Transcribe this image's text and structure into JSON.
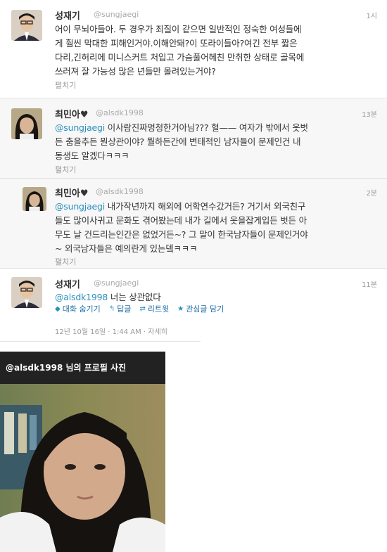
{
  "tweets": [
    {
      "name": "성재기",
      "handle": "@sungjaegi",
      "time": "1시",
      "lines": [
        "어이 무뇌아들아. 두 경우가 죄질이 같으면 일반적인 정숙한 여성들에",
        "게 훨씬 막대한 피해인거야.이해안돼?이 또라이들아?여긴 전부 짧은",
        "다리,긴허리에 미니스커트 처입고 가슴풀어헤친 만취한 상태로 골목에",
        "쓰러져 잘 가능성 많은 년들만 몰려있는거야?"
      ],
      "expand": "펼치기"
    },
    {
      "name": "최민아♥",
      "handle": "@alsdk1998",
      "time": "13분",
      "mention": "@sungjaegi",
      "lines": [
        " 이사람진짜멍청한거아님??? 헐—— 여자가 밖에서 옷벗",
        "든 춤을추든 뭔상관이야? 뭘하든간에 변태적인 남자들이 문제인건 내",
        "동생도 알겠다ㅋㅋㅋ"
      ],
      "expand": "펼치기"
    },
    {
      "name": "최민아♥",
      "handle": "@alsdk1998",
      "time": "2분",
      "mention": "@sungjaegi",
      "lines": [
        " 내가작년까지 해외에 어학연수갔거든? 거기서 외국친구",
        "들도 많이사귀고 문화도 겪어봤는데 내가 길에서 옷을잡게입든 벗든 아",
        "무도 날 건드리는인간은 없었거든~? 그 말이 한국남자들이 문제인거야",
        "~ 외국남자들은 예의란게 있는뎈ㅋㅋㅋ"
      ],
      "expand": "펼치기"
    },
    {
      "name": "성재기",
      "handle": "@sungjaegi",
      "time": "11분",
      "mention": "@alsdk1998",
      "lines": [
        " 너는 상관없다"
      ]
    }
  ],
  "actions": [
    {
      "icon": "speech-icon",
      "label": "대화 숨기기"
    },
    {
      "icon": "reply-icon",
      "label": "답글"
    },
    {
      "icon": "retweet-icon",
      "label": "리트윗"
    },
    {
      "icon": "star-icon",
      "label": "관심글 담기"
    }
  ],
  "meta": "12년 10월 16일 · 1:44 AM · 자세히",
  "photo": {
    "title": "@alsdk1998 님의 프로필 사진"
  }
}
